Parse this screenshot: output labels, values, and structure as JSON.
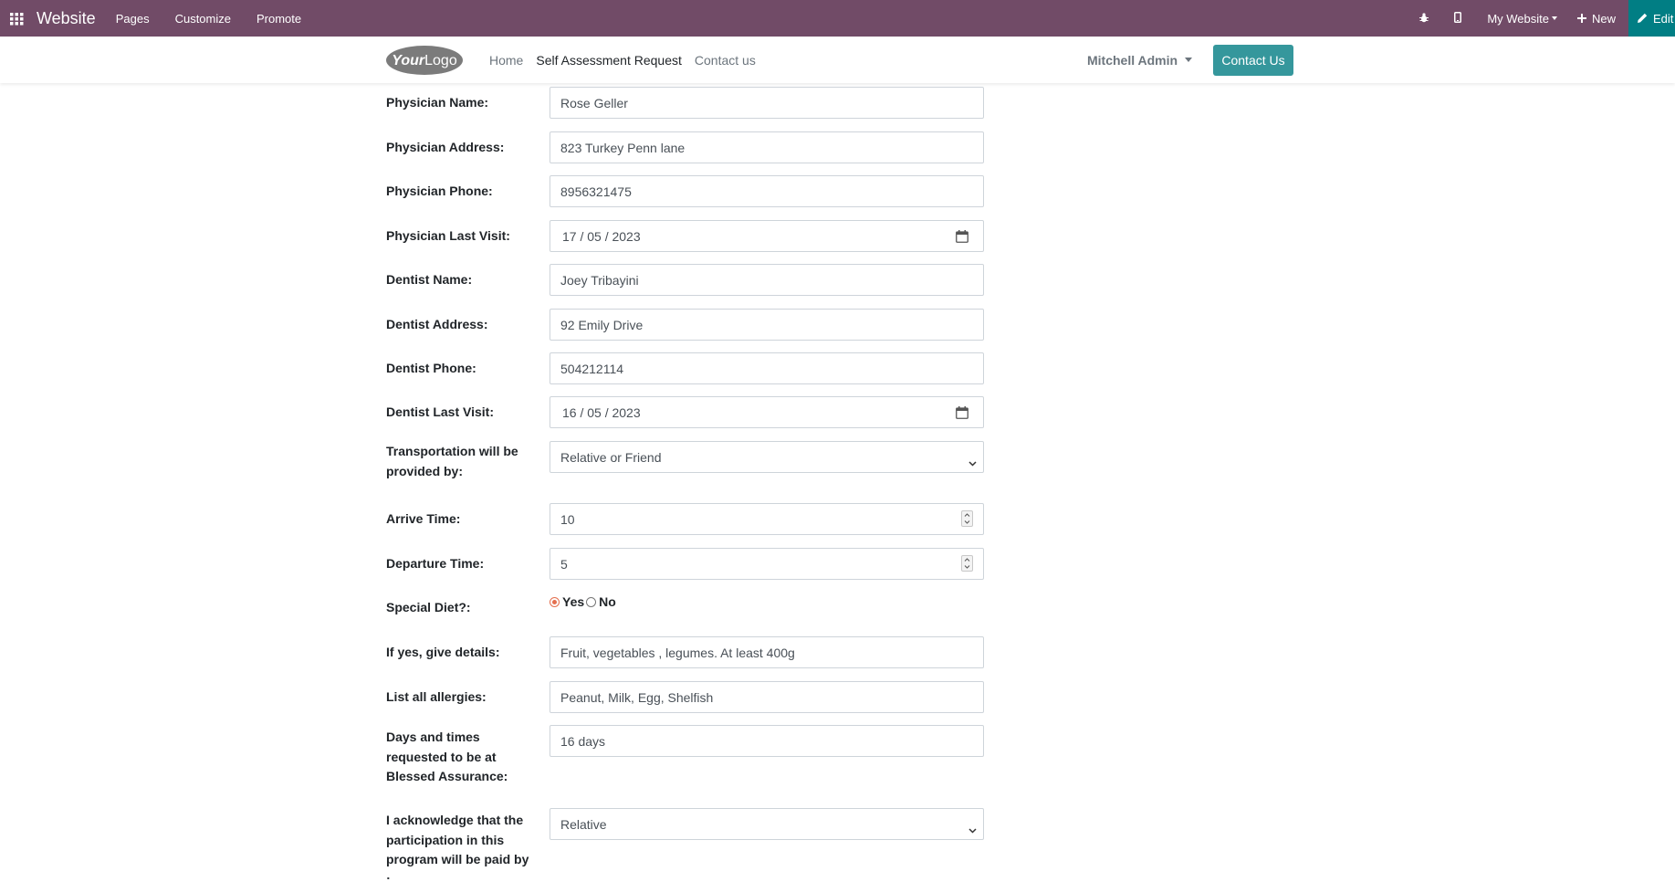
{
  "topbar": {
    "brand": "Website",
    "menu": [
      "Pages",
      "Customize",
      "Promote"
    ],
    "my_website": "My Website",
    "new_label": "New",
    "edit_label": "Edit"
  },
  "header": {
    "logo_text": "YourLogo",
    "nav": [
      "Home",
      "Self Assessment Request",
      "Contact us"
    ],
    "user": "Mitchell Admin",
    "contact_button": "Contact Us"
  },
  "form": {
    "physician_name": {
      "label": "Physician Name:",
      "value": "Rose Geller"
    },
    "physician_address": {
      "label": "Physician Address:",
      "value": "823 Turkey Penn lane"
    },
    "physician_phone": {
      "label": "Physician Phone:",
      "value": "8956321475"
    },
    "physician_last_visit": {
      "label": "Physician Last Visit:",
      "value": "17 / 05 / 2023"
    },
    "dentist_name": {
      "label": "Dentist Name:",
      "value": "Joey Tribayini"
    },
    "dentist_address": {
      "label": "Dentist Address:",
      "value": "92 Emily Drive"
    },
    "dentist_phone": {
      "label": "Dentist Phone:",
      "value": "504212114"
    },
    "dentist_last_visit": {
      "label": "Dentist Last Visit:",
      "value": "16 / 05 / 2023"
    },
    "transportation": {
      "label": "Transportation will be provided by:",
      "value": "Relative or Friend"
    },
    "arrive_time": {
      "label": "Arrive Time:",
      "value": "10"
    },
    "departure_time": {
      "label": "Departure Time:",
      "value": "5"
    },
    "special_diet": {
      "label": "Special Diet?:",
      "option_yes": "Yes",
      "option_no": "No",
      "selected": "Yes"
    },
    "diet_details": {
      "label": "If yes, give details:",
      "value": "Fruit, vegetables , legumes. At least 400g"
    },
    "allergies": {
      "label": "List all allergies:",
      "value": "Peanut, Milk, Egg, Shelfish"
    },
    "days_times": {
      "label": "Days and times requested to be at Blessed Assurance:",
      "value": "16 days"
    },
    "payment": {
      "label": "I acknowledge that the participation in this program will be paid by :",
      "value": "Relative"
    }
  },
  "colors": {
    "topbar": "#714b67",
    "edit": "#017e84",
    "contact_button": "#35979c"
  }
}
